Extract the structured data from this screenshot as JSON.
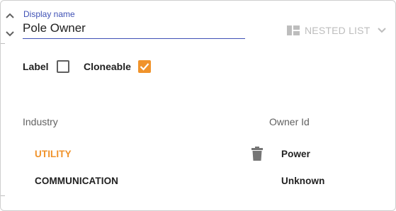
{
  "display_name": {
    "label": "Display name",
    "value": "Pole Owner"
  },
  "view_mode": {
    "label": "NESTED LIST",
    "icon": "dashboard-icon",
    "chevron_icon": "chevron-down-icon"
  },
  "options": {
    "label_text": "Label",
    "label_checked": false,
    "cloneable_text": "Cloneable",
    "cloneable_checked": true
  },
  "table": {
    "columns": [
      "Industry",
      "Owner Id"
    ],
    "rows": [
      {
        "industry": "UTILITY",
        "owner_id": "Power",
        "selected": true
      },
      {
        "industry": "COMMUNICATION",
        "owner_id": "Unknown",
        "selected": false
      }
    ],
    "delete_icon": "trash-icon"
  },
  "colors": {
    "accent": "#3f51b5",
    "selected_row": "#f0932b",
    "checkbox_checked": "#f0932b",
    "disabled_text": "#bdbdbd"
  }
}
